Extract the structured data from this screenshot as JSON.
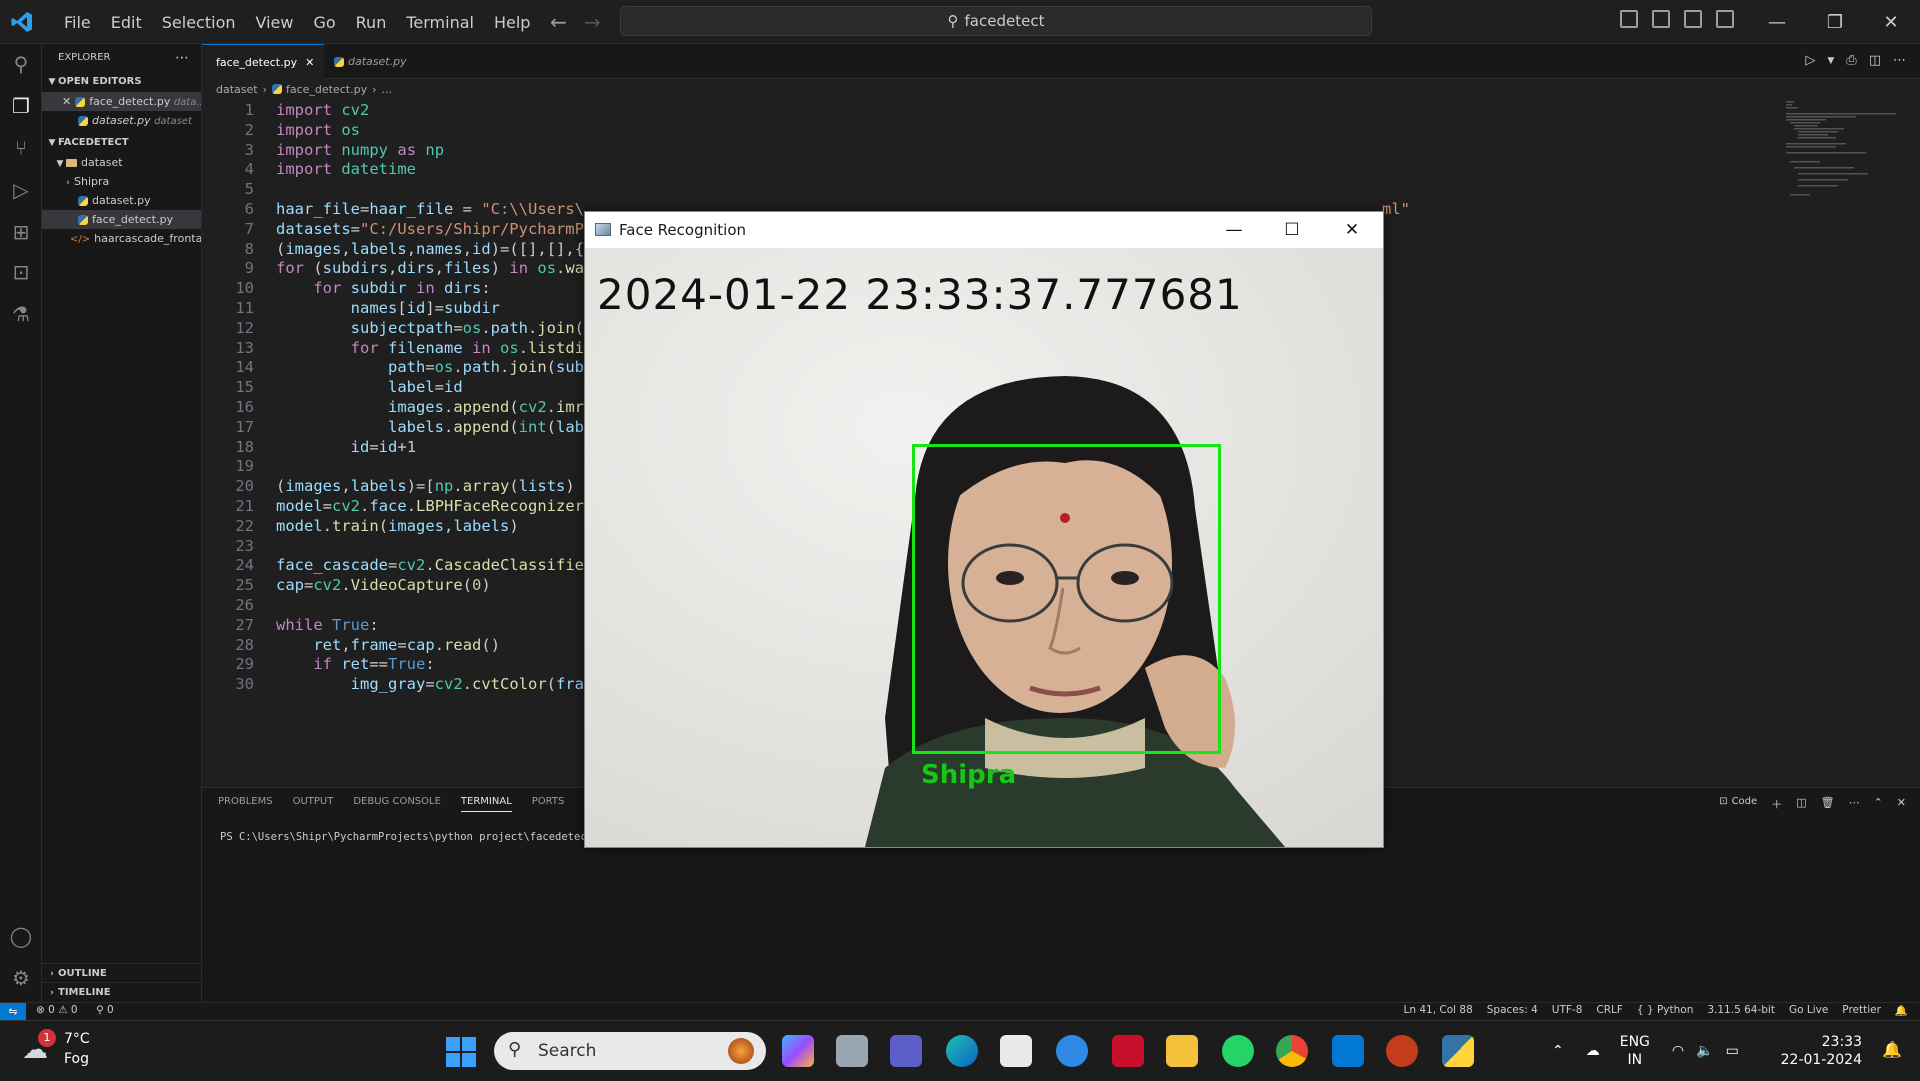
{
  "window": {
    "search_text": "facedetect"
  },
  "menu": [
    "File",
    "Edit",
    "Selection",
    "View",
    "Go",
    "Run",
    "Terminal",
    "Help"
  ],
  "explorer": {
    "title": "EXPLORER",
    "open_editors_title": "OPEN EDITORS",
    "open_editors": [
      {
        "name": "face_detect.py",
        "desc": "data..."
      },
      {
        "name": "dataset.py",
        "desc": "dataset"
      }
    ],
    "project_title": "FACEDETECT",
    "tree": [
      {
        "name": "dataset",
        "type": "folder"
      },
      {
        "name": "Shipra",
        "type": "folder"
      },
      {
        "name": "dataset.py",
        "type": "py"
      },
      {
        "name": "face_detect.py",
        "type": "py"
      },
      {
        "name": "haarcascade_frontalf...",
        "type": "xml"
      }
    ],
    "outline": "OUTLINE",
    "timeline": "TIMELINE"
  },
  "tabs": [
    {
      "label": "face_detect.py"
    },
    {
      "label": "dataset.py"
    }
  ],
  "breadcrumb": [
    "dataset",
    "face_detect.py",
    "..."
  ],
  "code_tail": "ml\"",
  "panel": {
    "tabs": [
      "PROBLEMS",
      "OUTPUT",
      "DEBUG CONSOLE",
      "TERMINAL",
      "PORTS"
    ],
    "prompt": "PS C:\\Users\\Shipr\\PycharmProjects\\python project\\facedetect>",
    "shell": "Code"
  },
  "statusbar": {
    "problems": "⊗ 0 ⚠ 0",
    "ports": "⚲ 0",
    "right": [
      "Ln 41, Col 88",
      "Spaces: 4",
      "UTF-8",
      "CRLF",
      "{ } Python",
      "3.11.5 64-bit",
      "Go Live",
      "Prettier"
    ]
  },
  "face_window": {
    "title": "Face Recognition",
    "timestamp": "2024-01-22 23:33:37.777681",
    "label": "Shipra"
  },
  "taskbar": {
    "temp": "7°C",
    "weather": "Fog",
    "badge": "1",
    "search_placeholder": "Search",
    "lang1": "ENG",
    "lang2": "IN",
    "time": "23:33",
    "date": "22-01-2024"
  }
}
